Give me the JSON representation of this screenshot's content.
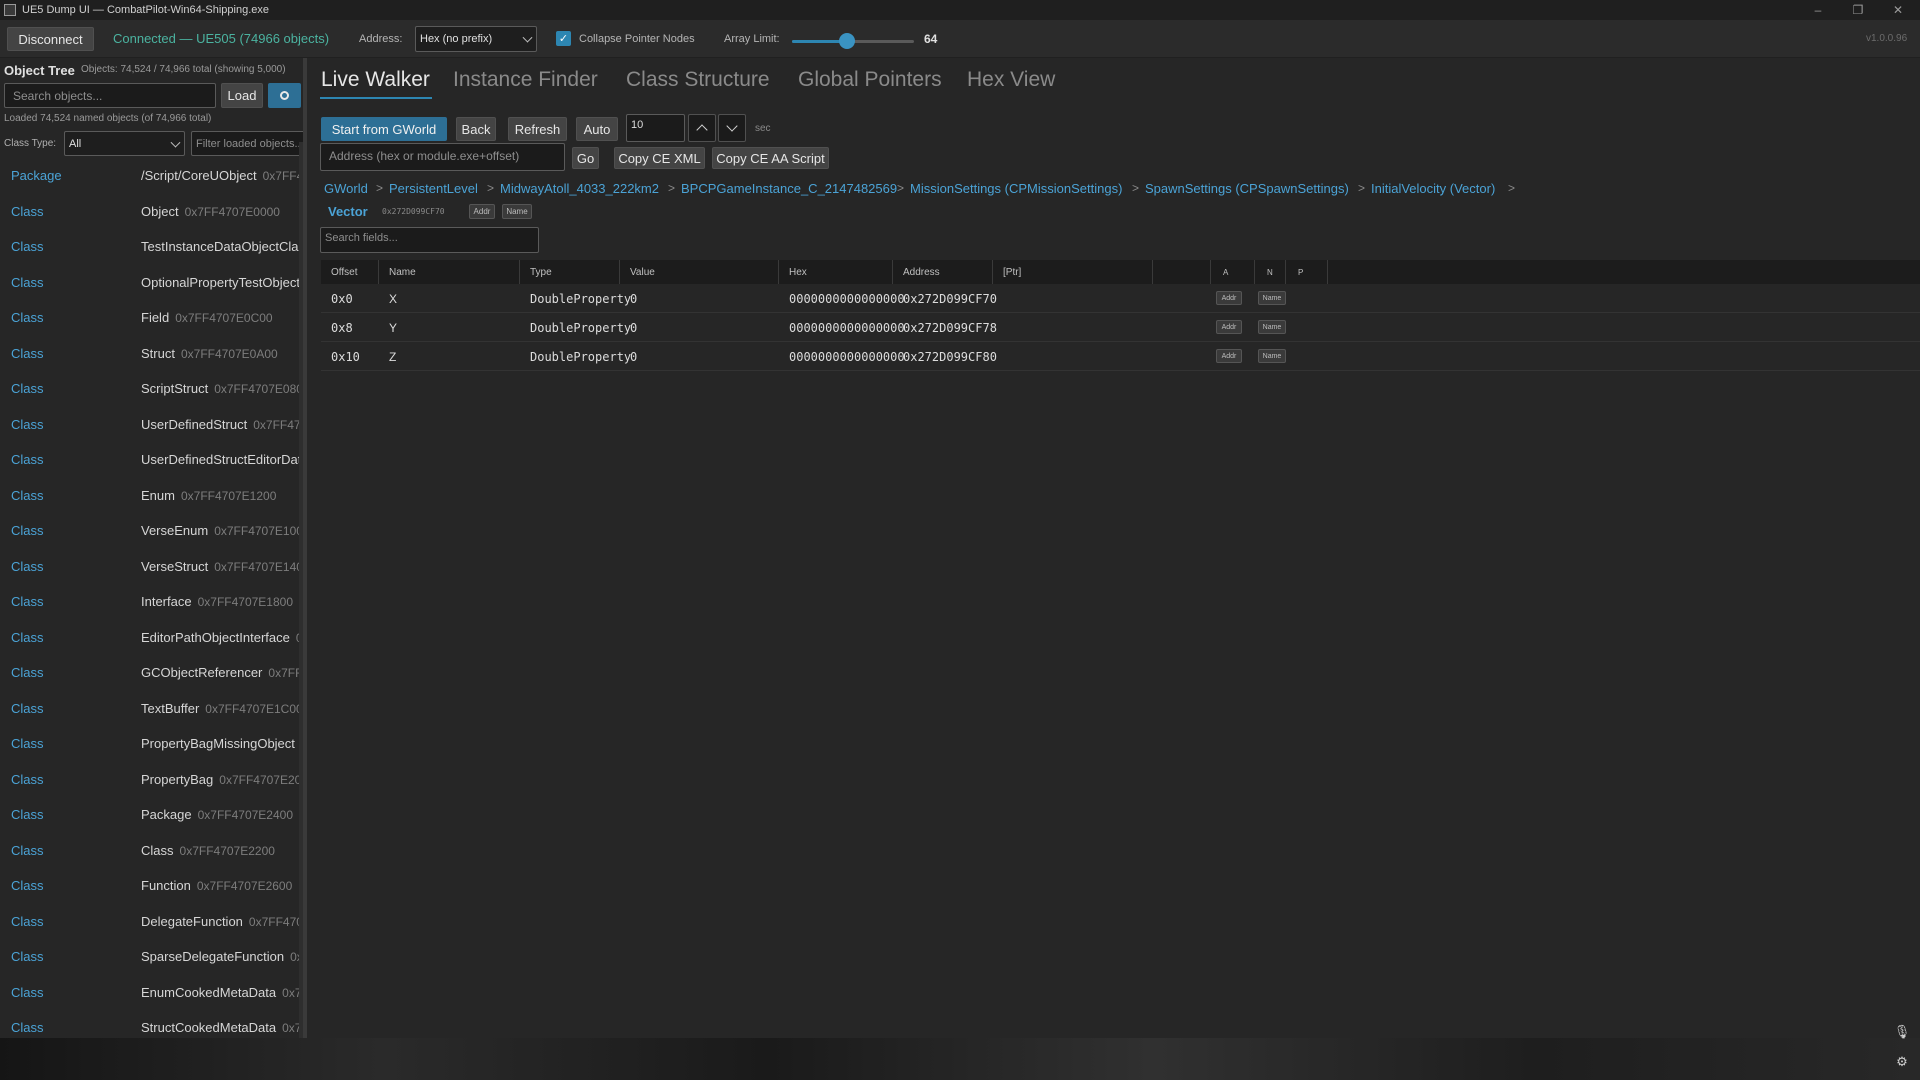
{
  "window": {
    "title": "UE5 Dump UI — CombatPilot-Win64-Shipping.exe",
    "minimize": "–",
    "maximize": "❐",
    "close": "✕"
  },
  "toolbar": {
    "disconnect_label": "Disconnect",
    "status": "Connected — UE505 (74966 objects)",
    "address_label": "Address:",
    "address_mode": "Hex (no prefix)",
    "collapse_label": "Collapse Pointer Nodes",
    "collapse_checked": true,
    "array_limit_label": "Array Limit:",
    "array_limit_value": "64",
    "array_limit_fraction": 0.45,
    "version": "v1.0.0.96",
    "colors": {
      "accent": "#2d86b2",
      "primary_button": "#2d6f95",
      "link": "#4ba3d6",
      "status": "#4bb3a0"
    }
  },
  "left": {
    "title": "Object Tree",
    "counts": "Objects: 74,524 / 74,966 total (showing 5,000)",
    "search_placeholder": "Search objects...",
    "load_label": "Load",
    "search_icon": "magnifier-icon",
    "loaded_text": "Loaded 74,524 named objects (of 74,966 total)",
    "class_type_label": "Class Type:",
    "class_type_value": "All",
    "filter_placeholder": "Filter loaded objects...",
    "items": [
      {
        "kind": "Package",
        "name": "/Script/CoreUObject",
        "addr": "0x7FF4"
      },
      {
        "kind": "Class",
        "name": "Object",
        "addr": "0x7FF4707E0000"
      },
      {
        "kind": "Class",
        "name": "TestInstanceDataObjectClass",
        "addr": ""
      },
      {
        "kind": "Class",
        "name": "OptionalPropertyTestObject",
        "addr": ""
      },
      {
        "kind": "Class",
        "name": "Field",
        "addr": "0x7FF4707E0C00"
      },
      {
        "kind": "Class",
        "name": "Struct",
        "addr": "0x7FF4707E0A00"
      },
      {
        "kind": "Class",
        "name": "ScriptStruct",
        "addr": "0x7FF4707E0800"
      },
      {
        "kind": "Class",
        "name": "UserDefinedStruct",
        "addr": "0x7FF47"
      },
      {
        "kind": "Class",
        "name": "UserDefinedStructEditorData",
        "addr": ""
      },
      {
        "kind": "Class",
        "name": "Enum",
        "addr": "0x7FF4707E1200"
      },
      {
        "kind": "Class",
        "name": "VerseEnum",
        "addr": "0x7FF4707E1000"
      },
      {
        "kind": "Class",
        "name": "VerseStruct",
        "addr": "0x7FF4707E1400"
      },
      {
        "kind": "Class",
        "name": "Interface",
        "addr": "0x7FF4707E1800"
      },
      {
        "kind": "Class",
        "name": "EditorPathObjectInterface",
        "addr": "0"
      },
      {
        "kind": "Class",
        "name": "GCObjectReferencer",
        "addr": "0x7FF4"
      },
      {
        "kind": "Class",
        "name": "TextBuffer",
        "addr": "0x7FF4707E1C00"
      },
      {
        "kind": "Class",
        "name": "PropertyBagMissingObject",
        "addr": ""
      },
      {
        "kind": "Class",
        "name": "PropertyBag",
        "addr": "0x7FF4707E2000"
      },
      {
        "kind": "Class",
        "name": "Package",
        "addr": "0x7FF4707E2400"
      },
      {
        "kind": "Class",
        "name": "Class",
        "addr": "0x7FF4707E2200"
      },
      {
        "kind": "Class",
        "name": "Function",
        "addr": "0x7FF4707E2600"
      },
      {
        "kind": "Class",
        "name": "DelegateFunction",
        "addr": "0x7FF470"
      },
      {
        "kind": "Class",
        "name": "SparseDelegateFunction",
        "addr": "0x"
      },
      {
        "kind": "Class",
        "name": "EnumCookedMetaData",
        "addr": "0x7"
      },
      {
        "kind": "Class",
        "name": "StructCookedMetaData",
        "addr": "0x7"
      }
    ]
  },
  "main": {
    "tabs": [
      "Live Walker",
      "Instance Finder",
      "Class Structure",
      "Global Pointers",
      "Hex View"
    ],
    "start_label": "Start from GWorld",
    "back_label": "Back",
    "refresh_label": "Refresh",
    "auto_label": "Auto",
    "interval_value": "10",
    "interval_unit": "sec",
    "address_placeholder": "Address (hex or module.exe+offset)",
    "go_label": "Go",
    "copy_xml_label": "Copy CE XML",
    "copy_aa_label": "Copy CE AA Script",
    "breadcrumbs": [
      "GWorld",
      "PersistentLevel",
      "MidwayAtoll_4033_222km2",
      "BPCPGameInstance_C_2147482569",
      "MissionSettings (CPMissionSettings)",
      "SpawnSettings (CPSpawnSettings)",
      "InitialVelocity (Vector)"
    ],
    "crumb_sep": ">",
    "object": {
      "type": "Vector",
      "addr": "0x272D099CF70",
      "addr_btn": "Addr",
      "name_btn": "Name"
    },
    "search_fields_placeholder": "Search fields...",
    "columns": [
      "Offset",
      "Name",
      "Type",
      "Value",
      "Hex",
      "Address",
      "[Ptr]",
      "",
      "A",
      "N",
      "P"
    ],
    "rows": [
      {
        "offset": "0x0",
        "name": "X",
        "type": "DoubleProperty",
        "value": "0",
        "hex": "0000000000000000",
        "address": "0x272D099CF70"
      },
      {
        "offset": "0x8",
        "name": "Y",
        "type": "DoubleProperty",
        "value": "0",
        "hex": "0000000000000000",
        "address": "0x272D099CF78"
      },
      {
        "offset": "0x10",
        "name": "Z",
        "type": "DoubleProperty",
        "value": "0",
        "hex": "0000000000000000",
        "address": "0x272D099CF80"
      }
    ],
    "row_addr_btn": "Addr",
    "row_name_btn": "Name"
  }
}
